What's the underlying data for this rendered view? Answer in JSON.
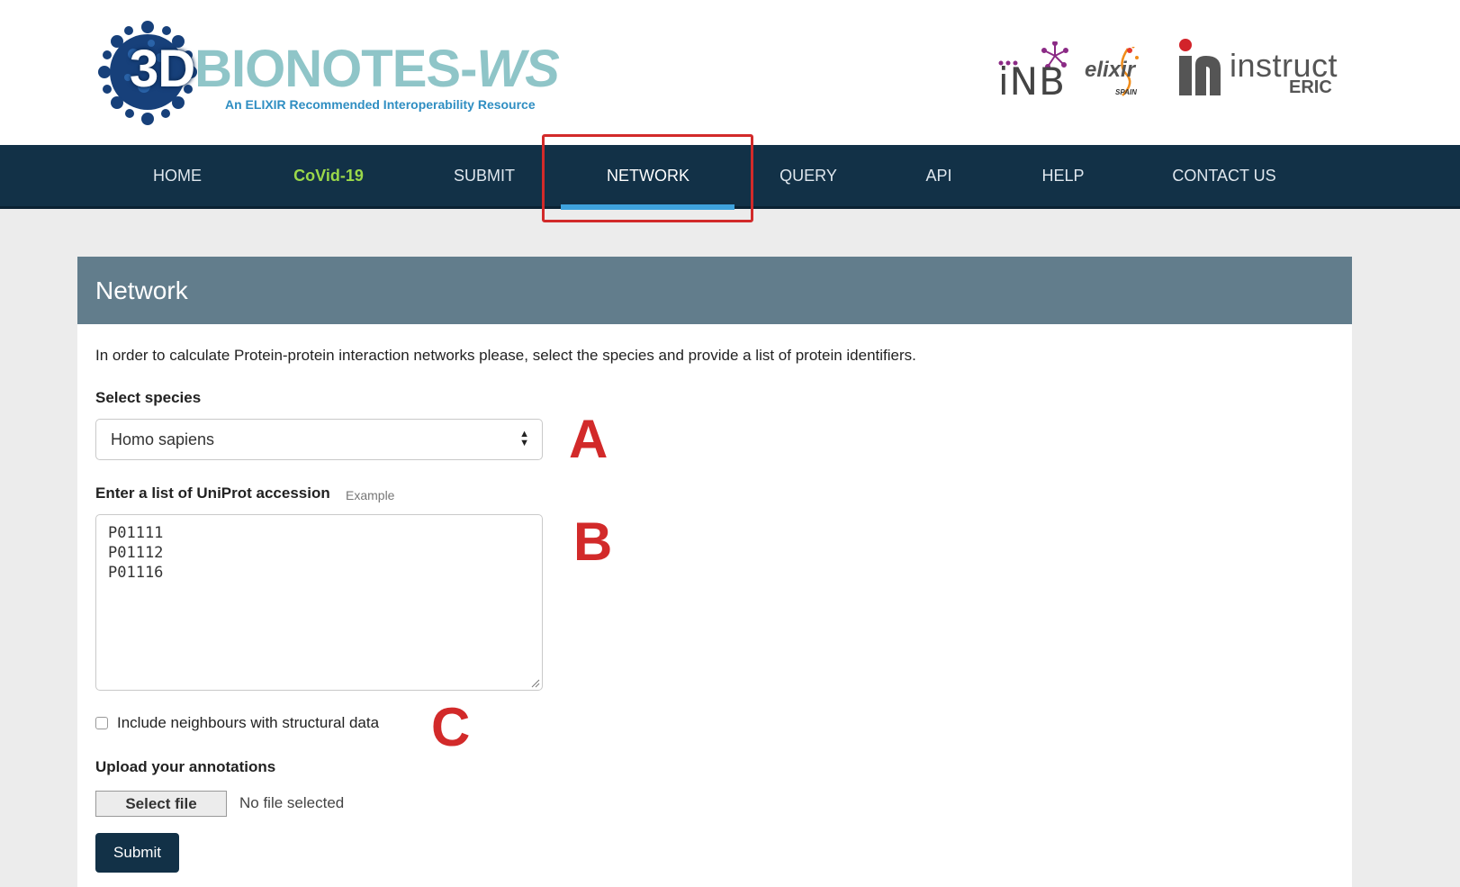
{
  "header": {
    "logo_3d": "3D",
    "logo_name": "BIONOTES-",
    "logo_ws": "WS",
    "logo_tagline": "An ELIXIR Recommended Interoperability Resource",
    "partners": {
      "inb": "iNB",
      "elixir": "elixir",
      "elixir_sub": "SPAIN",
      "instruct": "instruct",
      "instruct_sub": "ERIC"
    }
  },
  "nav": {
    "items": [
      {
        "label": "HOME"
      },
      {
        "label": "CoVid-19"
      },
      {
        "label": "SUBMIT"
      },
      {
        "label": "NETWORK"
      },
      {
        "label": "QUERY"
      },
      {
        "label": "API"
      },
      {
        "label": "HELP"
      },
      {
        "label": "CONTACT US"
      }
    ],
    "active": "NETWORK"
  },
  "panel": {
    "title": "Network",
    "intro": "In order to calculate Protein-protein interaction networks please, select the species and provide a list of protein identifiers.",
    "species_label": "Select species",
    "species_value": "Homo sapiens",
    "accession_label": "Enter a list of UniProt accession",
    "example_link": "Example",
    "accessions": [
      "P01111",
      "P01112",
      "P01116"
    ],
    "neighbours_label": "Include neighbours with structural data",
    "neighbours_checked": false,
    "upload_label": "Upload your annotations",
    "select_file_label": "Select file",
    "file_status": "No file selected",
    "submit_label": "Submit"
  },
  "annotations": {
    "a": "A",
    "b": "B",
    "c": "C"
  },
  "colors": {
    "navbar": "#123147",
    "covid": "#9ad84a",
    "active_indicator": "#3fa3de",
    "panel_header": "#627d8c",
    "annotation_red": "#d22a2a"
  },
  "icons": [
    "virus-icon",
    "inb-star-icon",
    "elixir-helix-icon",
    "instruct-mark-icon",
    "select-arrows-icon",
    "resize-grip-icon"
  ]
}
